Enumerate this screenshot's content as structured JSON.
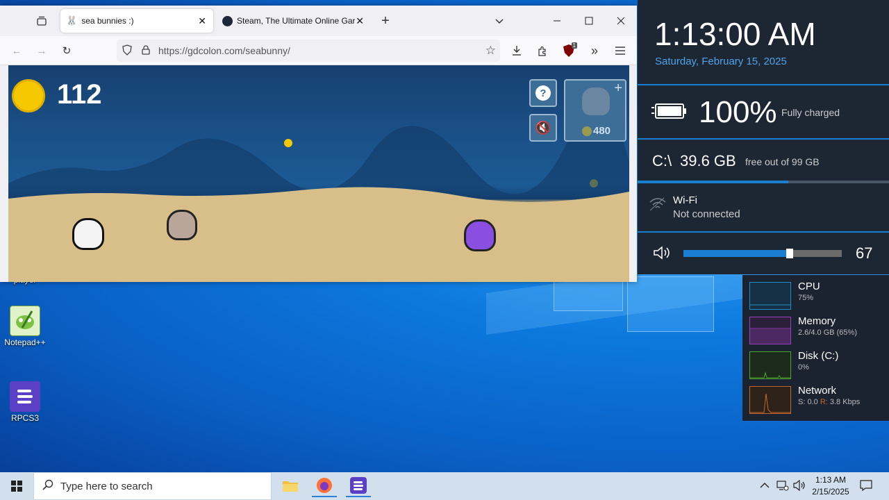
{
  "browser": {
    "tabs": [
      {
        "title": "sea bunnies :)",
        "active": true
      },
      {
        "title": "Steam, The Ultimate Online Gar",
        "active": false
      }
    ],
    "url": "https://gdcolon.com/seabunny/",
    "extension_badge": "1"
  },
  "game": {
    "coins": "112",
    "shop_price": "480",
    "colors": {
      "coin": "#f5c800",
      "sky": "#1a4f86",
      "sand": "#d9c08c"
    }
  },
  "clock": {
    "time": "1:13:00 AM",
    "date": "Saturday, February 15, 2025"
  },
  "battery": {
    "percent": "100%",
    "status": "Fully charged"
  },
  "disk": {
    "drive": "C:\\",
    "free": "39.6 GB",
    "detail": "free out of 99 GB",
    "used_fraction": 0.6
  },
  "wifi": {
    "name": "Wi-Fi",
    "status": "Not connected"
  },
  "volume": {
    "value": "67",
    "level": 0.67
  },
  "performance": [
    {
      "name": "CPU",
      "value": "75%",
      "color": "#1a8fc9"
    },
    {
      "name": "Memory",
      "value": "2.6/4.0 GB (65%)",
      "color": "#9a3fbf"
    },
    {
      "name": "Disk (C:)",
      "value": "0%",
      "color": "#4fa62e"
    },
    {
      "name": "Network",
      "value_send": "S: 0.0",
      "value_recv_label": "R:",
      "value_recv": "3.8 Kbps",
      "color": "#c7682b"
    }
  ],
  "desktop_icons": [
    {
      "label": "player"
    },
    {
      "label": "Notepad++"
    },
    {
      "label": "RPCS3"
    }
  ],
  "taskbar": {
    "search_placeholder": "Type here to search",
    "time": "1:13 AM",
    "date": "2/15/2025"
  }
}
